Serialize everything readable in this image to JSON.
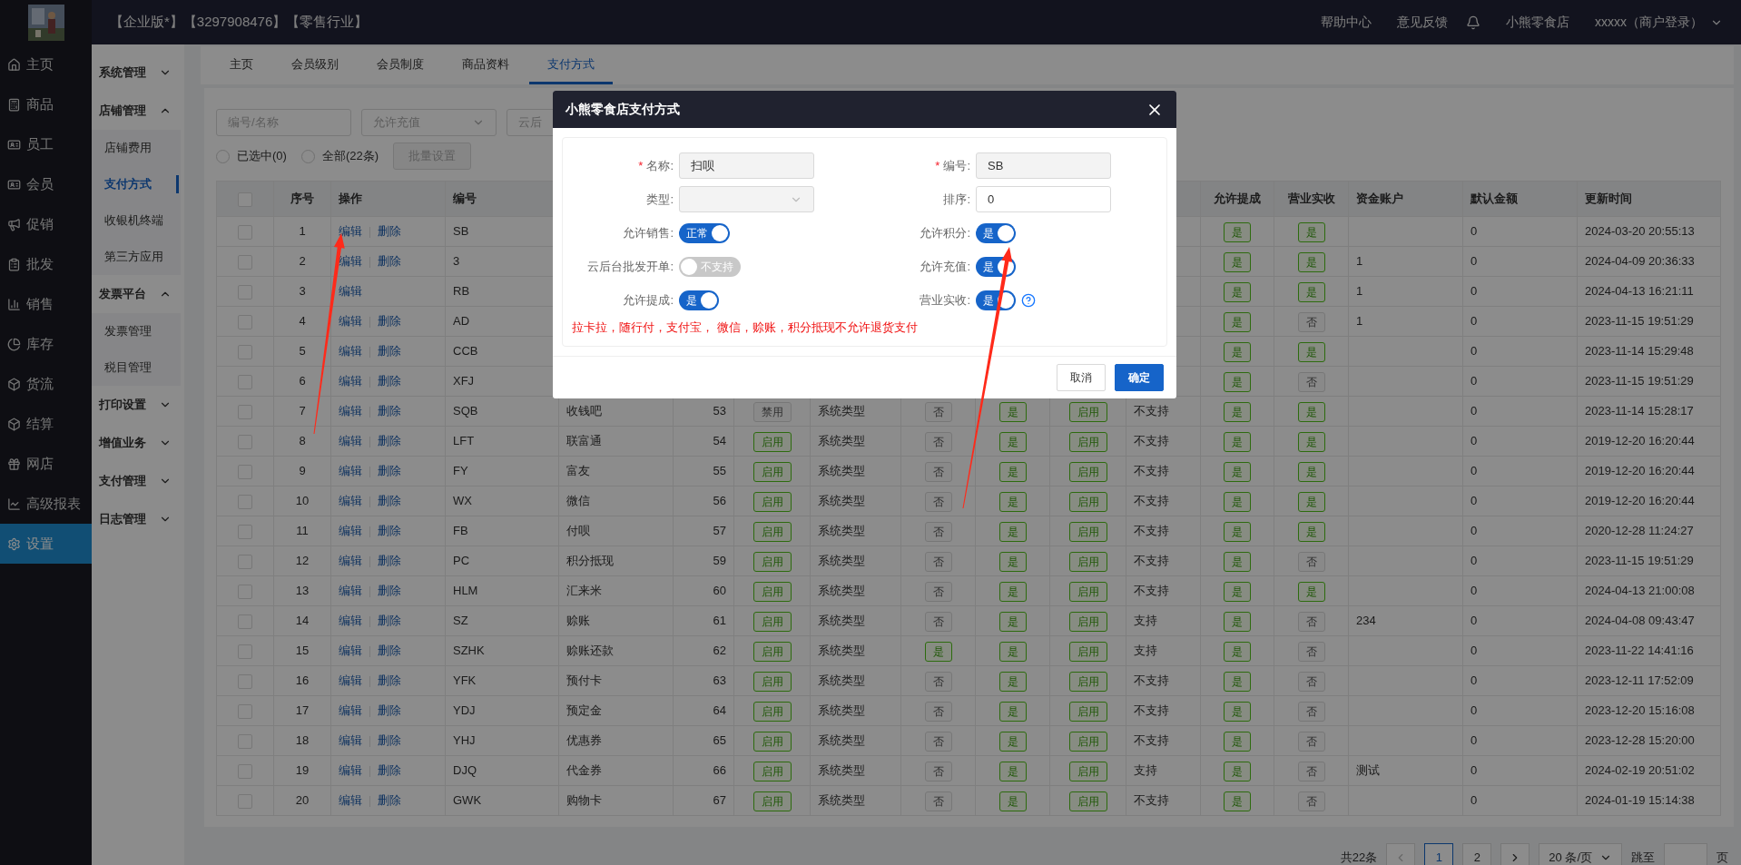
{
  "header": {
    "title": "【企业版*】【3297908476】【零售行业】",
    "links": [
      "帮助中心",
      "意见反馈"
    ],
    "store": "小熊零食店",
    "user": "xxxxx（商户登录）"
  },
  "nav": [
    {
      "label": "主页",
      "selected": false
    },
    {
      "label": "商品",
      "selected": false
    },
    {
      "label": "员工",
      "selected": false
    },
    {
      "label": "会员",
      "selected": false
    },
    {
      "label": "促销",
      "selected": false
    },
    {
      "label": "批发",
      "selected": false
    },
    {
      "label": "销售",
      "selected": false
    },
    {
      "label": "库存",
      "selected": false
    },
    {
      "label": "货流",
      "selected": false
    },
    {
      "label": "结算",
      "selected": false
    },
    {
      "label": "网店",
      "selected": false
    },
    {
      "label": "高级报表",
      "selected": false
    },
    {
      "label": "设置",
      "selected": true
    }
  ],
  "sidebar": {
    "items": [
      {
        "label": "系统管理",
        "expanded": false
      },
      {
        "label": "店铺管理",
        "expanded": true,
        "children": [
          {
            "label": "店铺费用",
            "selected": false
          },
          {
            "label": "支付方式",
            "selected": true
          },
          {
            "label": "收银机终端",
            "selected": false
          },
          {
            "label": "第三方应用",
            "selected": false
          }
        ]
      },
      {
        "label": "发票平台",
        "expanded": true,
        "children": [
          {
            "label": "发票管理",
            "selected": false
          },
          {
            "label": "税目管理",
            "selected": false
          }
        ]
      },
      {
        "label": "打印设置",
        "expanded": false
      },
      {
        "label": "增值业务",
        "expanded": false
      },
      {
        "label": "支付管理",
        "expanded": false
      },
      {
        "label": "日志管理",
        "expanded": false
      }
    ]
  },
  "tabs": [
    {
      "label": "主页",
      "selected": false
    },
    {
      "label": "会员级别",
      "selected": false
    },
    {
      "label": "会员制度",
      "selected": false
    },
    {
      "label": "商品资料",
      "selected": false
    },
    {
      "label": "支付方式",
      "selected": true
    }
  ],
  "filters": [
    {
      "kind": "input",
      "placeholder": "编号/名称"
    },
    {
      "kind": "select",
      "placeholder": "允许充值"
    },
    {
      "kind": "select_partial",
      "placeholder": "云后"
    }
  ],
  "selection": [
    {
      "label": "已选中(0)",
      "selected": false
    },
    {
      "label": "全部(22条)",
      "selected": false
    }
  ],
  "batch_button": {
    "label": "批量设置",
    "disabled": true
  },
  "table": {
    "header_checked": false,
    "columns_left": [
      "序号",
      "操作",
      "编号"
    ],
    "columns_right": [
      "允许提成",
      "营业实收",
      "资金账户",
      "默认金额",
      "更新时间"
    ],
    "rows": [
      {
        "checked": false,
        "index": "1",
        "actions": [
          "编辑",
          "删除"
        ],
        "code": "SB",
        "commission": {
          "label": "是",
          "on": true
        },
        "revenue": {
          "label": "是",
          "on": true
        },
        "amount": "0",
        "updated": "2024-03-20 20:55:13"
      },
      {
        "checked": false,
        "index": "2",
        "actions": [
          "编辑",
          "删除"
        ],
        "code": "3",
        "commission": {
          "label": "是",
          "on": true
        },
        "revenue": {
          "label": "是",
          "on": true
        },
        "account": "1",
        "amount": "0",
        "updated": "2024-04-09 20:36:33"
      },
      {
        "checked": false,
        "index": "3",
        "actions": [
          "编辑"
        ],
        "code": "RB",
        "commission": {
          "label": "是",
          "on": true
        },
        "revenue": {
          "label": "是",
          "on": true
        },
        "account": "1",
        "amount": "0",
        "updated": "2024-04-13 16:21:11"
      },
      {
        "checked": false,
        "index": "4",
        "actions": [
          "编辑",
          "删除"
        ],
        "code": "AD",
        "commission": {
          "label": "是",
          "on": true
        },
        "revenue": {
          "label": "否",
          "on": false
        },
        "account": "1",
        "amount": "0",
        "updated": "2023-11-15 19:51:29"
      },
      {
        "checked": false,
        "index": "5",
        "actions": [
          "编辑",
          "删除"
        ],
        "code": "CCB",
        "commission": {
          "label": "是",
          "on": true
        },
        "revenue": {
          "label": "是",
          "on": true
        },
        "amount": "0",
        "updated": "2023-11-14 15:29:48"
      },
      {
        "checked": false,
        "index": "6",
        "actions": [
          "编辑",
          "删除"
        ],
        "code": "XFJ",
        "commission": {
          "label": "是",
          "on": true
        },
        "revenue": {
          "label": "否",
          "on": false
        },
        "amount": "0",
        "updated": "2023-11-15 19:51:29"
      },
      {
        "checked": false,
        "index": "7",
        "actions": [
          "编辑",
          "删除"
        ],
        "code": "SQB",
        "column_5": "收钱吧",
        "column_6": "53",
        "column_7": {
          "label": "禁用",
          "on": false
        },
        "column_8": "系统类型",
        "column_9": {
          "label": "否",
          "on": false
        },
        "column_10": {
          "label": "是",
          "on": true
        },
        "column_11": {
          "label": "启用",
          "on": true
        },
        "column_12": "不支持",
        "commission": {
          "label": "是",
          "on": true
        },
        "revenue": {
          "label": "是",
          "on": true
        },
        "amount": "0",
        "updated": "2023-11-14 15:28:17"
      },
      {
        "checked": false,
        "index": "8",
        "actions": [
          "编辑",
          "删除"
        ],
        "code": "LFT",
        "column_5": "联富通",
        "column_6": "54",
        "column_7": {
          "label": "启用",
          "on": true
        },
        "column_8": "系统类型",
        "column_9": {
          "label": "否",
          "on": false
        },
        "column_10": {
          "label": "是",
          "on": true
        },
        "column_11": {
          "label": "启用",
          "on": true
        },
        "column_12": "不支持",
        "commission": {
          "label": "是",
          "on": true
        },
        "revenue": {
          "label": "是",
          "on": true
        },
        "amount": "0",
        "updated": "2019-12-20 16:20:44"
      },
      {
        "checked": false,
        "index": "9",
        "actions": [
          "编辑",
          "删除"
        ],
        "code": "FY",
        "column_5": "富友",
        "column_6": "55",
        "column_7": {
          "label": "启用",
          "on": true
        },
        "column_8": "系统类型",
        "column_9": {
          "label": "否",
          "on": false
        },
        "column_10": {
          "label": "是",
          "on": true
        },
        "column_11": {
          "label": "启用",
          "on": true
        },
        "column_12": "不支持",
        "commission": {
          "label": "是",
          "on": true
        },
        "revenue": {
          "label": "是",
          "on": true
        },
        "amount": "0",
        "updated": "2019-12-20 16:20:44"
      },
      {
        "checked": false,
        "index": "10",
        "actions": [
          "编辑",
          "删除"
        ],
        "code": "WX",
        "column_5": "微信",
        "column_6": "56",
        "column_7": {
          "label": "启用",
          "on": true
        },
        "column_8": "系统类型",
        "column_9": {
          "label": "否",
          "on": false
        },
        "column_10": {
          "label": "是",
          "on": true
        },
        "column_11": {
          "label": "启用",
          "on": true
        },
        "column_12": "不支持",
        "commission": {
          "label": "是",
          "on": true
        },
        "revenue": {
          "label": "是",
          "on": true
        },
        "amount": "0",
        "updated": "2019-12-20 16:20:44"
      },
      {
        "checked": false,
        "index": "11",
        "actions": [
          "编辑",
          "删除"
        ],
        "code": "FB",
        "column_5": "付呗",
        "column_6": "57",
        "column_7": {
          "label": "启用",
          "on": true
        },
        "column_8": "系统类型",
        "column_9": {
          "label": "否",
          "on": false
        },
        "column_10": {
          "label": "是",
          "on": true
        },
        "column_11": {
          "label": "启用",
          "on": true
        },
        "column_12": "不支持",
        "commission": {
          "label": "是",
          "on": true
        },
        "revenue": {
          "label": "是",
          "on": true
        },
        "amount": "0",
        "updated": "2020-12-28 11:24:27"
      },
      {
        "checked": false,
        "index": "12",
        "actions": [
          "编辑",
          "删除"
        ],
        "code": "PC",
        "column_5": "积分抵现",
        "column_6": "59",
        "column_7": {
          "label": "启用",
          "on": true
        },
        "column_8": "系统类型",
        "column_9": {
          "label": "否",
          "on": false
        },
        "column_10": {
          "label": "是",
          "on": true
        },
        "column_11": {
          "label": "启用",
          "on": true
        },
        "column_12": "不支持",
        "commission": {
          "label": "是",
          "on": true
        },
        "revenue": {
          "label": "否",
          "on": false
        },
        "amount": "0",
        "updated": "2023-11-15 19:51:29"
      },
      {
        "checked": false,
        "index": "13",
        "actions": [
          "编辑",
          "删除"
        ],
        "code": "HLM",
        "column_5": "汇来米",
        "column_6": "60",
        "column_7": {
          "label": "启用",
          "on": true
        },
        "column_8": "系统类型",
        "column_9": {
          "label": "否",
          "on": false
        },
        "column_10": {
          "label": "是",
          "on": true
        },
        "column_11": {
          "label": "启用",
          "on": true
        },
        "column_12": "不支持",
        "commission": {
          "label": "是",
          "on": true
        },
        "revenue": {
          "label": "是",
          "on": true
        },
        "amount": "0",
        "updated": "2024-04-13 21:00:08"
      },
      {
        "checked": false,
        "index": "14",
        "actions": [
          "编辑",
          "删除"
        ],
        "code": "SZ",
        "column_5": "赊账",
        "column_6": "61",
        "column_7": {
          "label": "启用",
          "on": true
        },
        "column_8": "系统类型",
        "column_9": {
          "label": "否",
          "on": false
        },
        "column_10": {
          "label": "是",
          "on": true
        },
        "column_11": {
          "label": "启用",
          "on": true
        },
        "column_12": "支持",
        "commission": {
          "label": "是",
          "on": true
        },
        "revenue": {
          "label": "否",
          "on": false
        },
        "account": "234",
        "amount": "0",
        "updated": "2024-04-08 09:43:47"
      },
      {
        "checked": false,
        "index": "15",
        "actions": [
          "编辑",
          "删除"
        ],
        "code": "SZHK",
        "column_5": "赊账还款",
        "column_6": "62",
        "column_7": {
          "label": "启用",
          "on": true
        },
        "column_8": "系统类型",
        "column_9": {
          "label": "是",
          "on": true
        },
        "column_10": {
          "label": "是",
          "on": true
        },
        "column_11": {
          "label": "启用",
          "on": true
        },
        "column_12": "支持",
        "commission": {
          "label": "是",
          "on": true
        },
        "revenue": {
          "label": "否",
          "on": false
        },
        "amount": "0",
        "updated": "2023-11-22 14:41:16"
      },
      {
        "checked": false,
        "index": "16",
        "actions": [
          "编辑",
          "删除"
        ],
        "code": "YFK",
        "column_5": "预付卡",
        "column_6": "63",
        "column_7": {
          "label": "启用",
          "on": true
        },
        "column_8": "系统类型",
        "column_9": {
          "label": "否",
          "on": false
        },
        "column_10": {
          "label": "是",
          "on": true
        },
        "column_11": {
          "label": "启用",
          "on": true
        },
        "column_12": "不支持",
        "commission": {
          "label": "是",
          "on": true
        },
        "revenue": {
          "label": "否",
          "on": false
        },
        "amount": "0",
        "updated": "2023-12-11 17:52:09"
      },
      {
        "checked": false,
        "index": "17",
        "actions": [
          "编辑",
          "删除"
        ],
        "code": "YDJ",
        "column_5": "预定金",
        "column_6": "64",
        "column_7": {
          "label": "启用",
          "on": true
        },
        "column_8": "系统类型",
        "column_9": {
          "label": "否",
          "on": false
        },
        "column_10": {
          "label": "是",
          "on": true
        },
        "column_11": {
          "label": "启用",
          "on": true
        },
        "column_12": "不支持",
        "commission": {
          "label": "是",
          "on": true
        },
        "revenue": {
          "label": "否",
          "on": false
        },
        "amount": "0",
        "updated": "2023-12-20 15:16:08"
      },
      {
        "checked": false,
        "index": "18",
        "actions": [
          "编辑",
          "删除"
        ],
        "code": "YHJ",
        "column_5": "优惠券",
        "column_6": "65",
        "column_7": {
          "label": "启用",
          "on": true
        },
        "column_8": "系统类型",
        "column_9": {
          "label": "否",
          "on": false
        },
        "column_10": {
          "label": "是",
          "on": true
        },
        "column_11": {
          "label": "启用",
          "on": true
        },
        "column_12": "不支持",
        "commission": {
          "label": "是",
          "on": true
        },
        "revenue": {
          "label": "否",
          "on": false
        },
        "amount": "0",
        "updated": "2023-12-28 15:20:00"
      },
      {
        "checked": false,
        "index": "19",
        "actions": [
          "编辑",
          "删除"
        ],
        "code": "DJQ",
        "column_5": "代金券",
        "column_6": "66",
        "column_7": {
          "label": "启用",
          "on": true
        },
        "column_8": "系统类型",
        "column_9": {
          "label": "否",
          "on": false
        },
        "column_10": {
          "label": "是",
          "on": true
        },
        "column_11": {
          "label": "启用",
          "on": true
        },
        "column_12": "支持",
        "commission": {
          "label": "是",
          "on": true
        },
        "revenue": {
          "label": "否",
          "on": false
        },
        "account": "测试",
        "amount": "0",
        "updated": "2024-02-19 20:51:02"
      },
      {
        "checked": false,
        "index": "20",
        "actions": [
          "编辑",
          "删除"
        ],
        "code": "GWK",
        "column_5": "购物卡",
        "column_6": "67",
        "column_7": {
          "label": "启用",
          "on": true
        },
        "column_8": "系统类型",
        "column_9": {
          "label": "否",
          "on": false
        },
        "column_10": {
          "label": "是",
          "on": true
        },
        "column_11": {
          "label": "启用",
          "on": true
        },
        "column_12": "不支持",
        "commission": {
          "label": "是",
          "on": true
        },
        "revenue": {
          "label": "否",
          "on": false
        },
        "amount": "0",
        "updated": "2024-01-19 15:14:38"
      }
    ]
  },
  "pagination": {
    "total": "共22条",
    "pages": [
      {
        "label": "1",
        "selected": true
      },
      {
        "label": "2",
        "selected": false
      }
    ],
    "page_size": "20 条/页",
    "jump_label": "跳至",
    "suffix": "页"
  },
  "dialog": {
    "title": "小熊零食店支付方式",
    "fields": [
      {
        "kind": "input",
        "label": "名称:",
        "required_mark": "*",
        "value": "扫呗",
        "disabled": true
      },
      {
        "kind": "input",
        "label": "编号:",
        "required_mark": "*",
        "value": "SB",
        "disabled": true
      },
      {
        "kind": "select",
        "label": "类型:",
        "disabled": true
      },
      {
        "kind": "input",
        "label": "排序:",
        "value": "0",
        "disabled": false
      },
      {
        "kind": "toggle",
        "label": "允许销售:",
        "on": true,
        "text": "正常"
      },
      {
        "kind": "toggle",
        "label": "允许积分:",
        "on": true,
        "text": "是"
      },
      {
        "kind": "toggle",
        "label": "云后台批发开单:",
        "on": false,
        "text": "不支持"
      },
      {
        "kind": "toggle",
        "label": "允许充值:",
        "on": true,
        "text": "是"
      },
      {
        "kind": "toggle",
        "label": "允许提成:",
        "on": true,
        "text": "是"
      },
      {
        "kind": "toggle",
        "label": "营业实收:",
        "on": true,
        "text": "是",
        "help": true
      }
    ],
    "note": "拉卡拉，随行付，支付宝， 微信，赊账，积分抵现不允许退货支付",
    "buttons": [
      {
        "label": "取消",
        "primary": false
      },
      {
        "label": "确定",
        "primary": true
      }
    ]
  }
}
